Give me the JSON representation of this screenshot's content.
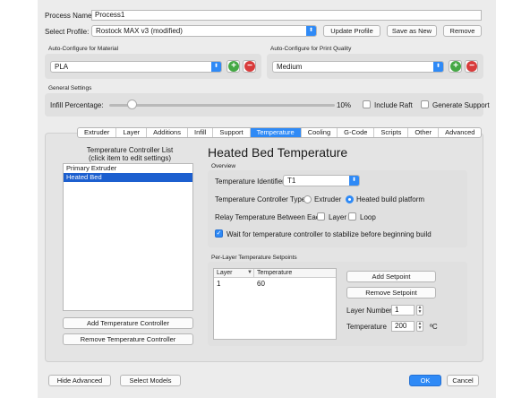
{
  "process_name": {
    "label": "Process Name:",
    "value": "Process1"
  },
  "profile": {
    "label": "Select Profile:",
    "selected": "Rostock MAX v3 (modified)",
    "update_button": "Update Profile",
    "save_as_new_button": "Save as New",
    "remove_button": "Remove"
  },
  "material": {
    "title": "Auto-Configure for Material",
    "selected": "PLA"
  },
  "quality": {
    "title": "Auto-Configure for Print Quality",
    "selected": "Medium"
  },
  "general": {
    "title": "General Settings",
    "infill_label": "Infill Percentage:",
    "infill_value_text": "10%",
    "infill_fraction": 0.1,
    "include_raft": "Include Raft",
    "generate_support": "Generate Support"
  },
  "tabs": [
    "Extruder",
    "Layer",
    "Additions",
    "Infill",
    "Support",
    "Temperature",
    "Cooling",
    "G-Code",
    "Scripts",
    "Other",
    "Advanced"
  ],
  "active_tab": "Temperature",
  "controller_list": {
    "heading_line1": "Temperature Controller List",
    "heading_line2": "(click item to edit settings)",
    "items": [
      "Primary Extruder",
      "Heated Bed"
    ],
    "selected_index": 1,
    "add_button": "Add Temperature Controller",
    "remove_button": "Remove Temperature Controller"
  },
  "detail": {
    "title": "Heated Bed Temperature",
    "overview_title": "Overview",
    "identifier_label": "Temperature Identifier",
    "identifier_value": "T1",
    "type_label": "Temperature Controller Type:",
    "type_extruder": "Extruder",
    "type_bed": "Heated build platform",
    "relay_label": "Relay Temperature Between Each:",
    "relay_layer": "Layer",
    "relay_loop": "Loop",
    "wait_label": "Wait for temperature controller to stabilize before beginning build"
  },
  "setpoints": {
    "title": "Per-Layer Temperature Setpoints",
    "col_layer": "Layer",
    "col_temp": "Temperature",
    "rows": [
      {
        "layer": "1",
        "temp": "60"
      }
    ],
    "add_button": "Add Setpoint",
    "remove_button": "Remove Setpoint",
    "layer_number_label": "Layer Number",
    "layer_number_value": "1",
    "temperature_label": "Temperature",
    "temperature_value": "200",
    "unit": "ºC"
  },
  "footer": {
    "hide_advanced": "Hide Advanced",
    "select_models": "Select Models",
    "ok": "OK",
    "cancel": "Cancel"
  },
  "colors": {
    "accent": "#2f8af6",
    "selection": "#1c5fcf",
    "add": "#45a845",
    "remove": "#d83b3b"
  }
}
